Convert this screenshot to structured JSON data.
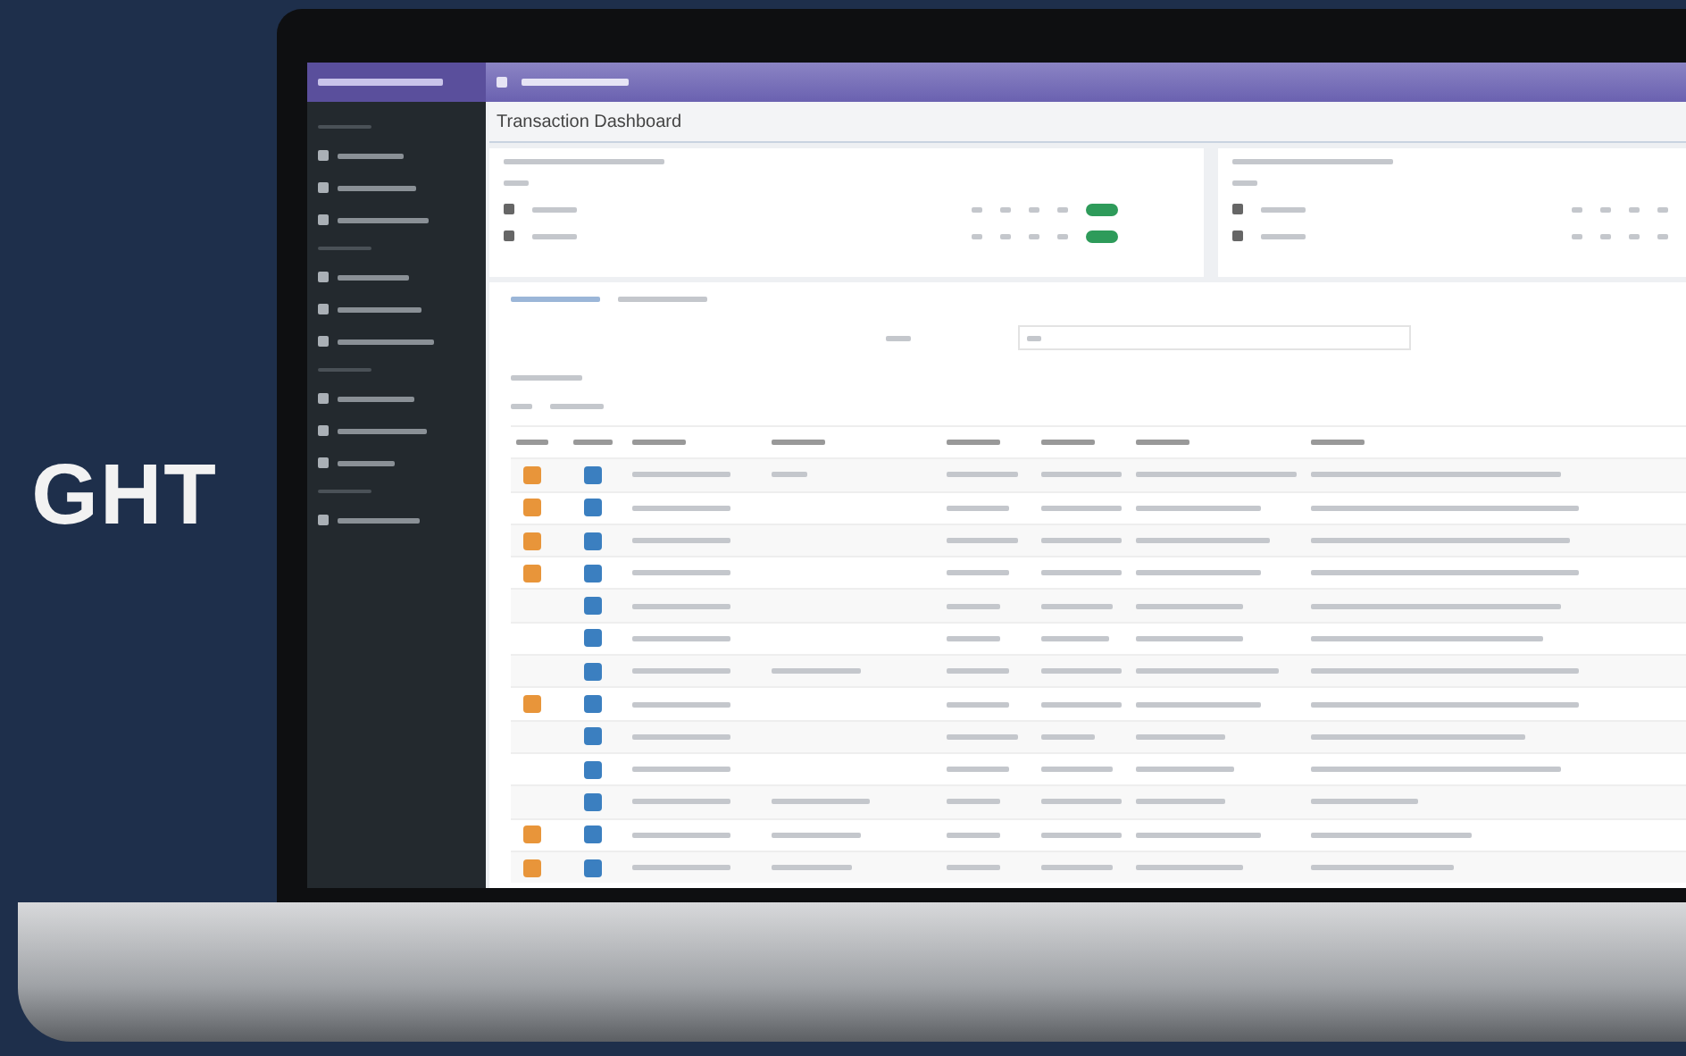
{
  "headline": "GHT",
  "app": {
    "page_title": "Transaction Dashboard",
    "summary_panels": [
      {
        "rows": [
          {
            "badge": true
          },
          {
            "badge": true
          }
        ]
      },
      {
        "rows": [
          {
            "badge": false
          },
          {
            "badge": false
          }
        ]
      }
    ],
    "rows": [
      {
        "has_action": true
      },
      {
        "has_action": true
      },
      {
        "has_action": true
      },
      {
        "has_action": true
      },
      {
        "has_action": false
      },
      {
        "has_action": false
      },
      {
        "has_action": false
      },
      {
        "has_action": true
      },
      {
        "has_action": false
      },
      {
        "has_action": false
      },
      {
        "has_action": false
      },
      {
        "has_action": true
      },
      {
        "has_action": true
      }
    ]
  }
}
